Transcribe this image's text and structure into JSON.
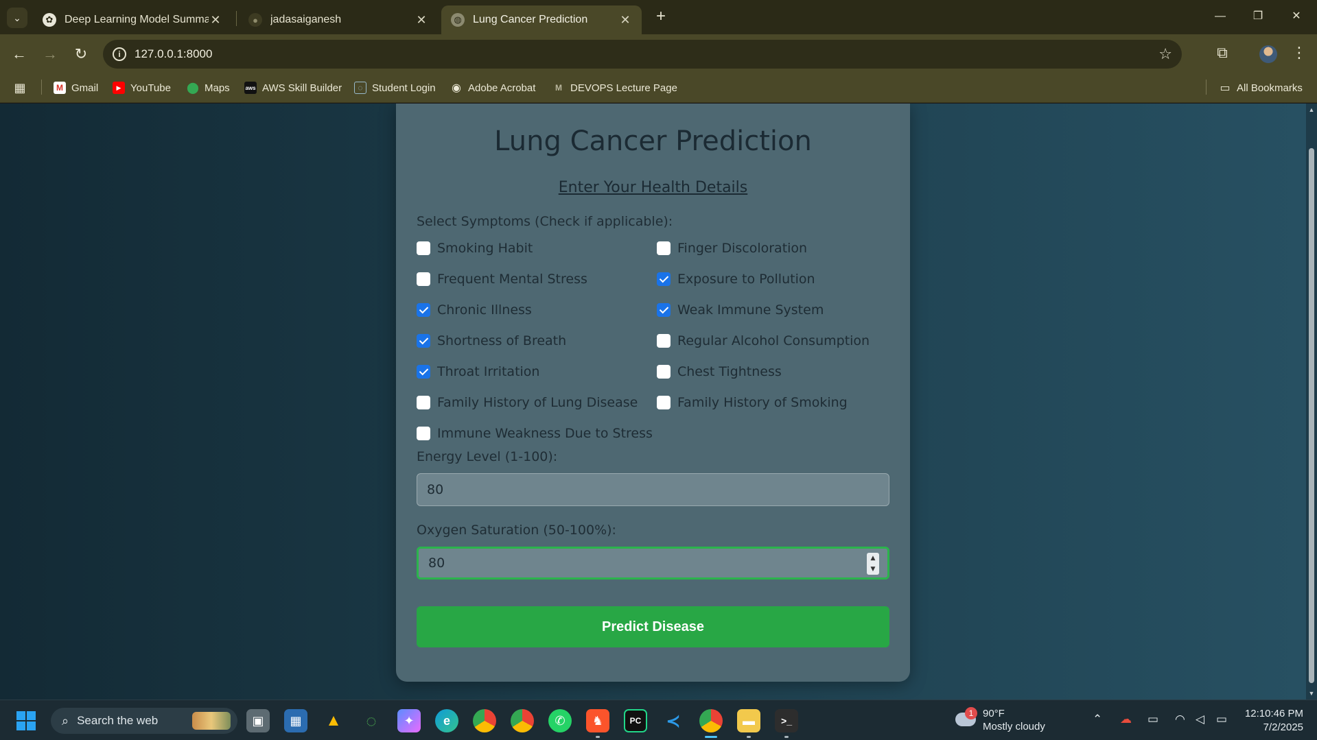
{
  "browser": {
    "tabs": [
      {
        "label": "Deep Learning Model Summary",
        "icon": "openai-icon"
      },
      {
        "label": "jadasaiganesh",
        "icon": "github-icon"
      },
      {
        "label": "Lung Cancer Prediction",
        "icon": "globe-icon",
        "active": true
      }
    ],
    "url": "127.0.0.1:8000",
    "bookmarks": [
      {
        "label": "Gmail",
        "icon": "gmail-icon"
      },
      {
        "label": "YouTube",
        "icon": "youtube-icon"
      },
      {
        "label": "Maps",
        "icon": "maps-icon"
      },
      {
        "label": "AWS Skill Builder",
        "icon": "aws-icon"
      },
      {
        "label": "Student Login",
        "icon": "student-icon"
      },
      {
        "label": "Adobe Acrobat",
        "icon": "adobe-icon"
      },
      {
        "label": "DEVOPS Lecture Page",
        "icon": "gmail-icon"
      }
    ],
    "all_bookmarks": "All Bookmarks"
  },
  "page": {
    "title": "Lung Cancer Prediction",
    "subtitle": "Enter Your Health Details",
    "symptoms_label": "Select Symptoms (Check if applicable):",
    "symptoms": [
      {
        "label": "Smoking Habit",
        "checked": false
      },
      {
        "label": "Finger Discoloration",
        "checked": false
      },
      {
        "label": "Frequent Mental Stress",
        "checked": false
      },
      {
        "label": "Exposure to Pollution",
        "checked": true
      },
      {
        "label": "Chronic Illness",
        "checked": true
      },
      {
        "label": "Weak Immune System",
        "checked": true
      },
      {
        "label": "Shortness of Breath",
        "checked": true
      },
      {
        "label": "Regular Alcohol Consumption",
        "checked": false
      },
      {
        "label": "Throat Irritation",
        "checked": true
      },
      {
        "label": "Chest Tightness",
        "checked": false
      },
      {
        "label": "Family History of Lung Disease",
        "checked": false
      },
      {
        "label": "Family History of Smoking",
        "checked": false
      },
      {
        "label": "Immune Weakness Due to Stress",
        "checked": false
      }
    ],
    "energy_label": "Energy Level (1-100):",
    "energy_value": "80",
    "oxygen_label": "Oxygen Saturation (50-100%):",
    "oxygen_value": "80",
    "predict_label": "Predict Disease",
    "colors": {
      "accent": "#28a745",
      "checkbox": "#1a73e8"
    }
  },
  "taskbar": {
    "search_placeholder": "Search the web",
    "weather_badge": "1",
    "weather_temp": "90°F",
    "weather_desc": "Mostly cloudy",
    "time": "12:10:46 PM",
    "date": "7/2/2025"
  }
}
